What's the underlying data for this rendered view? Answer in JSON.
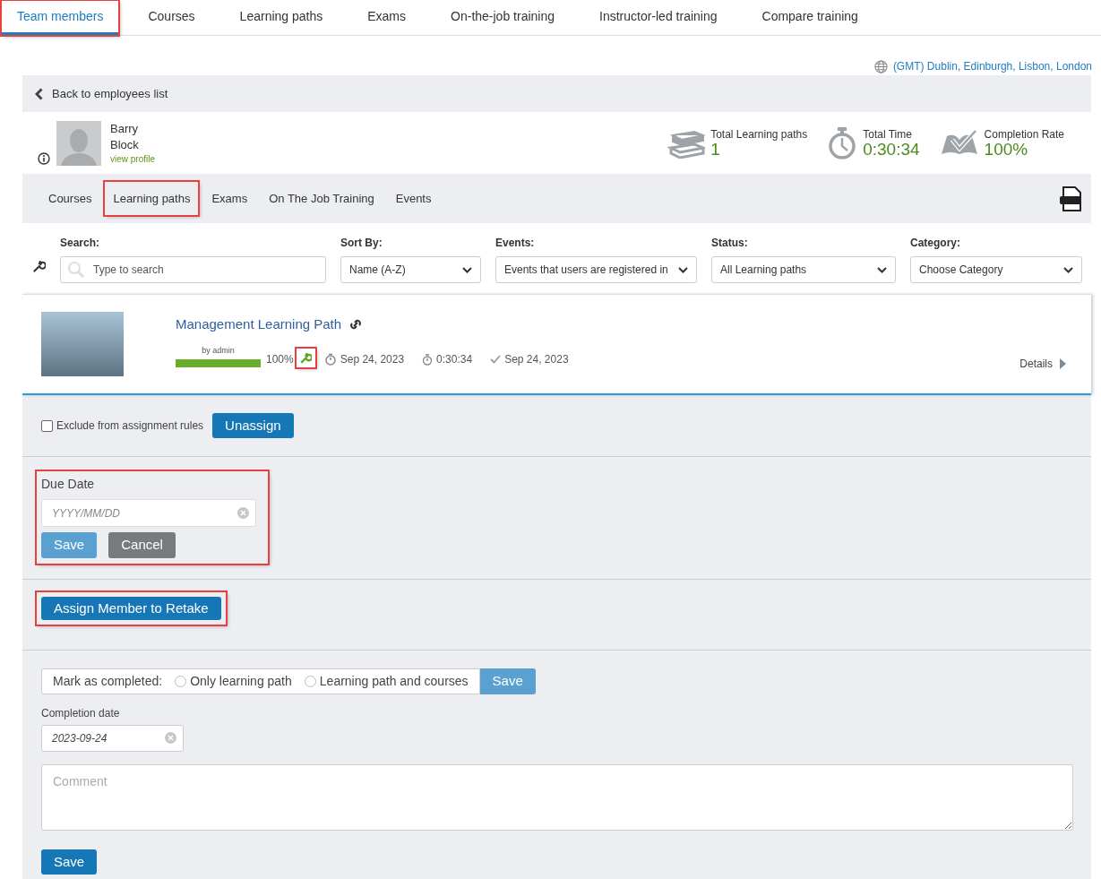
{
  "top_tabs": [
    {
      "label": "Team members",
      "selected": true,
      "highlighted": true
    },
    {
      "label": "Courses",
      "selected": false,
      "highlighted": false
    },
    {
      "label": "Learning paths",
      "selected": false,
      "highlighted": false
    },
    {
      "label": "Exams",
      "selected": false,
      "highlighted": false
    },
    {
      "label": "On-the-job training",
      "selected": false,
      "highlighted": false
    },
    {
      "label": "Instructor-led training",
      "selected": false,
      "highlighted": false
    },
    {
      "label": "Compare training",
      "selected": false,
      "highlighted": false
    }
  ],
  "timezone": "(GMT) Dublin, Edinburgh, Lisbon, London",
  "back_link": "Back to employees list",
  "profile": {
    "first_name": "Barry",
    "last_name": "Block",
    "link": "view profile"
  },
  "stats": [
    {
      "kind": "books",
      "label": "Total Learning paths",
      "value": "1"
    },
    {
      "kind": "timer",
      "label": "Total Time",
      "value": "0:30:34"
    },
    {
      "kind": "completion",
      "label": "Completion Rate",
      "value": "100%"
    }
  ],
  "sub_tabs": [
    {
      "label": "Courses",
      "highlighted": false
    },
    {
      "label": "Learning paths",
      "highlighted": true
    },
    {
      "label": "Exams",
      "highlighted": false
    },
    {
      "label": "On The Job Training",
      "highlighted": false
    },
    {
      "label": "Events",
      "highlighted": false
    }
  ],
  "filters": [
    {
      "kind": "search",
      "label": "Search:",
      "placeholder": "Type to search"
    },
    {
      "kind": "select",
      "label": "Sort By:",
      "value": "Name (A-Z)"
    },
    {
      "kind": "select",
      "label": "Events:",
      "value": "Events that users are registered in"
    },
    {
      "kind": "select",
      "label": "Status:",
      "value": "All Learning paths"
    },
    {
      "kind": "select",
      "label": "Category:",
      "value": "Choose Category"
    }
  ],
  "learning_path": {
    "title": "Management Learning Path",
    "author": "by admin",
    "level": 1,
    "percent": "100%",
    "wrench_highlighted": true,
    "start_date": "Sep 24, 2023",
    "time": "0:30:34",
    "completed_date": "Sep 24, 2023",
    "details": "Details"
  },
  "exclude": {
    "label": "Exclude from assignment rules",
    "checked": false
  },
  "unassign_button": "Unassign",
  "due_date": {
    "label": "Due Date",
    "placeholder": "YYYY/MM/DD",
    "save": "Save",
    "cancel": "Cancel",
    "highlighted": true
  },
  "retake_button": {
    "label": "Assign Member to Retake",
    "highlighted": true
  },
  "mark_completed": {
    "label": "Mark as completed:",
    "options": [
      {
        "label": "Only learning path",
        "selected": false
      },
      {
        "label": "Learning path and courses",
        "selected": false
      }
    ],
    "save": "Save"
  },
  "completion_date": {
    "label": "Completion date",
    "value": "2023-09-24"
  },
  "comment": {
    "placeholder": "Comment"
  },
  "save_button": "Save"
}
